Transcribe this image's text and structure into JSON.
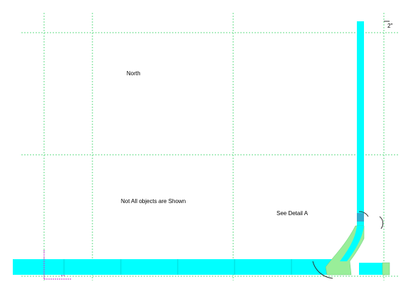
{
  "labels": {
    "north": "North",
    "note": "Not All objects are Shown",
    "detail": "See Detail A",
    "dimension": "2\""
  },
  "colors": {
    "background": "#ffffff",
    "grid": "#66dd88",
    "wall": "#00ffff",
    "fill": "#99ee99",
    "ucs": "#cc33cc",
    "arc": "#333333"
  }
}
